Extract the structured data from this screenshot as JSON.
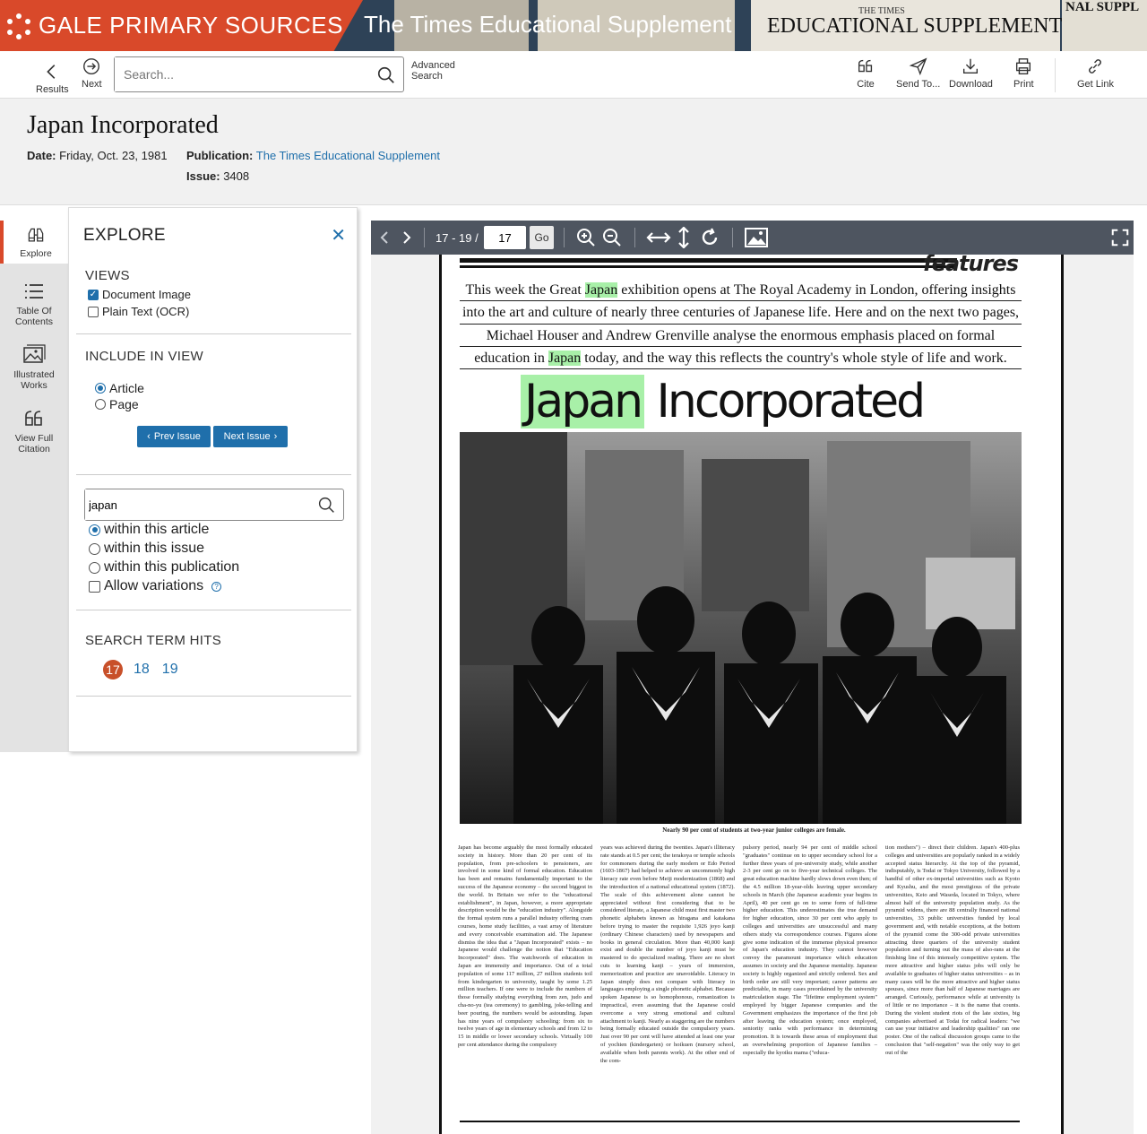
{
  "banner": {
    "brand": "GALE PRIMARY SOURCES",
    "publication_title": "The Times Educational Supplement",
    "masthead_text": "EDUCATIONAL SUPPLEMENT",
    "masthead_small": "THE TIMES",
    "masthead_right": "NAL  SUPPL",
    "colors": {
      "brand": "#d9492a",
      "banner_bg": "#2e4257"
    }
  },
  "toolbar": {
    "results": "Results",
    "next": "Next",
    "search_placeholder": "Search...",
    "advanced_search": "Advanced Search",
    "cite": "Cite",
    "send_to": "Send To...",
    "download": "Download",
    "print": "Print",
    "get_link": "Get Link"
  },
  "document": {
    "title": "Japan Incorporated",
    "date_label": "Date:",
    "date_value": "Friday,  Oct. 23, 1981",
    "publication_label": "Publication:",
    "publication_value": "The Times Educational Supplement",
    "issue_label": "Issue:",
    "issue_value": "3408"
  },
  "rail": {
    "explore": "Explore",
    "toc": "Table Of Contents",
    "illustrated": "Illustrated Works",
    "citation": "View Full Citation"
  },
  "explore": {
    "header": "EXPLORE",
    "views_title": "VIEWS",
    "document_image": "Document Image",
    "plain_text": "Plain Text (OCR)",
    "include_title": "INCLUDE IN VIEW",
    "article": "Article",
    "page": "Page",
    "prev_issue": "Prev Issue",
    "next_issue": "Next Issue",
    "search_term": "japan",
    "within_article": "within this article",
    "within_issue": "within this issue",
    "within_publication": "within this publication",
    "allow_variations": "Allow variations",
    "hits_title": "SEARCH TERM HITS",
    "hits": [
      "17",
      "18",
      "19"
    ],
    "current_hit": "17"
  },
  "viewer": {
    "page_range": "17 - 19 /",
    "page_value": "17",
    "go": "Go"
  },
  "article": {
    "section_tag": "features",
    "intro": [
      [
        "This week the Great ",
        "Japan",
        " exhibition opens at The Royal Academy in London, offering insights"
      ],
      [
        "into the art and culture of nearly three centuries of Japanese life. Here and on the next two pages,",
        "",
        ""
      ],
      [
        "Michael Houser and Andrew Grenville analyse the enormous emphasis placed on formal",
        "",
        ""
      ],
      [
        "education in ",
        "Japan",
        " today, and the way this reflects the country's whole style of life and work."
      ]
    ],
    "headline_hl": "Japan",
    "headline_rest": " Incorporated",
    "caption": "Nearly 90 per cent of students at two-year junior colleges are female.",
    "columns": [
      "Japan has become arguably the most formally educated society in history. More than 20 per cent of its population, from pre-schoolers to pensioners, are involved in some kind of formal education. Education has been and remains fundamentally important to the success of the Japanese economy – the second biggest in the world. In Britain we refer to the \"educational establishment\", in Japan, however, a more appropriate description would be the \"education industry\". Alongside the formal system runs a parallel industry offering cram courses, home study facilities, a vast array of literature and every conceivable examination aid. The Japanese dismiss the idea that a \"Japan Incorporated\" exists – no Japanese would challenge the notion that \"Education Incorporated\" does. The watchwords of education in Japan are immensity and importance. Out of a total population of some 117 million, 27 million students toil from kindergarten to university, taught by some 1.25 million teachers. If one were to include the numbers of those formally studying everything from zen, judo and cha-no-yu (tea ceremony) to gambling, joke-telling and beer pouring, the numbers would be astounding. Japan has nine years of compulsory schooling: from six to twelve years of age in elementary schools and from 12 to 15 in middle or lower secondary schools. Virtually 100 per cent attendance during the compulsory",
      "years was achieved during the twenties. Japan's illiteracy rate stands at 0.5 per cent; the terakoya or temple schools for commoners during the early modern or Edo Period (1603-1867) had helped to achieve an uncommonly high literacy rate even before Meiji modernization (1868) and the introduction of a national educational system (1872). The scale of this achievement alone cannot be appreciated without first considering that to be considered literate, a Japanese child must first master two phonetic alphabets known as hiragana and katakana before trying to master the requisite 1,926 joyo kanji (ordinary Chinese characters) used by newspapers and books in general circulation. More than 40,000 kanji exist and double the number of joyo kanji must be mastered to do specialized reading. There are no short cuts to learning kanji – years of immersion, memorization and practice are unavoidable. Literacy in Japan simply does not compare with literacy in languages employing a single phonetic alphabet. Because spoken Japanese is so homophonous, romanization is impractical, even assuming that the Japanese could overcome a very strong emotional and cultural attachment to kanji. Nearly as staggering are the numbers being formally educated outside the compulsory years. Just over 90 per cent will have attended at least one year of yochien (kindergarten) or hoikuen (nursery school, available when both parents work). At the other end of the com-",
      "pulsory period, nearly 94 per cent of middle school \"graduates\" continue on to upper secondary school for a further three years of pre-university study, while another 2-3 per cent go on to five-year technical colleges. The great education machine hardly slows down even then; of the 4.5 million 18-year-olds leaving upper secondary schools in March (the Japanese academic year begins in April), 40 per cent go on to some form of full-time higher education. This underestimates the true demand for higher education, since 30 per cent who apply to colleges and universities are unsuccessful and many others study via correspondence courses. Figures alone give some indication of the immense physical presence of Japan's education industry. They cannot however convey the paramount importance which education assumes in society and the Japanese mentality. Japanese society is highly organized and strictly ordered. Sex and birth order are still very important; career patterns are predictable, in many cases preordained by the university matriculation stage. The \"lifetime employment system\" employed by bigger Japanese companies and the Government emphasizes the importance of the first job after leaving the education system; once employed, seniority ranks with performance in determining promotion. It is towards these areas of employment that an overwhelming proportion of Japanese families – especially the kyoiku mama (\"educa-",
      "tion mothers\") – direct their children. Japan's 400-plus colleges and universities are popularly ranked in a widely accepted status hierarchy. At the top of the pyramid, indisputably, is Todai or Tokyo University, followed by a handful of other ex-imperial universities such as Kyoto and Kyushu, and the most prestigious of the private universities, Keio and Waseda, located in Tokyo, where almost half of the university population study. As the pyramid widens, there are 88 centrally financed national universities, 33 public universities funded by local government and, with notable exceptions, at the bottom of the pyramid come the 300-odd private universities attracting three quarters of the university student population and turning out the mass of also-rans at the finishing line of this intensely competitive system. The more attractive and higher status jobs will only be available to graduates of higher status universities – as in many cases will be the more attractive and higher status spouses, since more than half of Japanese marriages are arranged. Curiously, performance while at university is of little or no importance – it is the name that counts. During the violent student riots of the late sixties, big companies advertised at Todai for radical leaders: \"we can use your initiative and leadership qualities\" ran one poster. One of the radical discussion groups came to the conclusion that \"self-negation\" was the only way to get out of the"
    ]
  }
}
